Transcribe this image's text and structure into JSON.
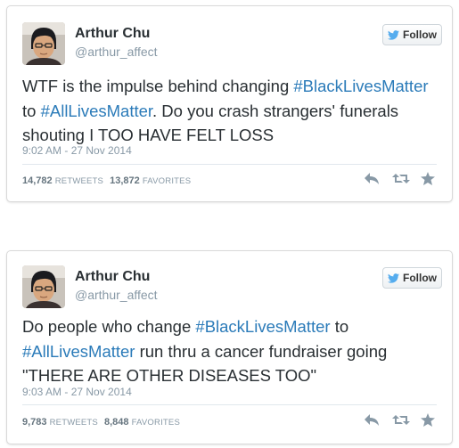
{
  "tweets": [
    {
      "author_name": "Arthur Chu",
      "author_handle": "@arthur_affect",
      "follow_label": "Follow",
      "segments": [
        {
          "text": "WTF is the impulse behind changing ",
          "hashtag": false
        },
        {
          "text": "#BlackLivesMatter",
          "hashtag": true
        },
        {
          "text": " to ",
          "hashtag": false
        },
        {
          "text": "#AllLivesMatter",
          "hashtag": true
        },
        {
          "text": ". Do you crash strangers' funerals shouting I TOO HAVE FELT LOSS",
          "hashtag": false
        }
      ],
      "timestamp": "9:02 AM - 27 Nov 2014",
      "retweets_count": "14,782",
      "retweets_label": "RETWEETS",
      "favorites_count": "13,872",
      "favorites_label": "FAVORITES"
    },
    {
      "author_name": "Arthur Chu",
      "author_handle": "@arthur_affect",
      "follow_label": "Follow",
      "segments": [
        {
          "text": "Do people who change ",
          "hashtag": false
        },
        {
          "text": "#BlackLivesMatter",
          "hashtag": true
        },
        {
          "text": " to ",
          "hashtag": false
        },
        {
          "text": "#AllLivesMatter",
          "hashtag": true
        },
        {
          "text": " run thru a cancer fundraiser going \"THERE ARE OTHER DISEASES TOO\"",
          "hashtag": false
        }
      ],
      "timestamp": "9:03 AM - 27 Nov 2014",
      "retweets_count": "9,783",
      "retweets_label": "RETWEETS",
      "favorites_count": "8,848",
      "favorites_label": "FAVORITES"
    }
  ],
  "colors": {
    "hashtag": "#2b7bb9",
    "twitter_blue": "#55acee",
    "muted": "#8899a6"
  },
  "icons": [
    "avatar-photo",
    "twitter-bird-icon",
    "reply-icon",
    "retweet-icon",
    "favorite-star-icon"
  ]
}
